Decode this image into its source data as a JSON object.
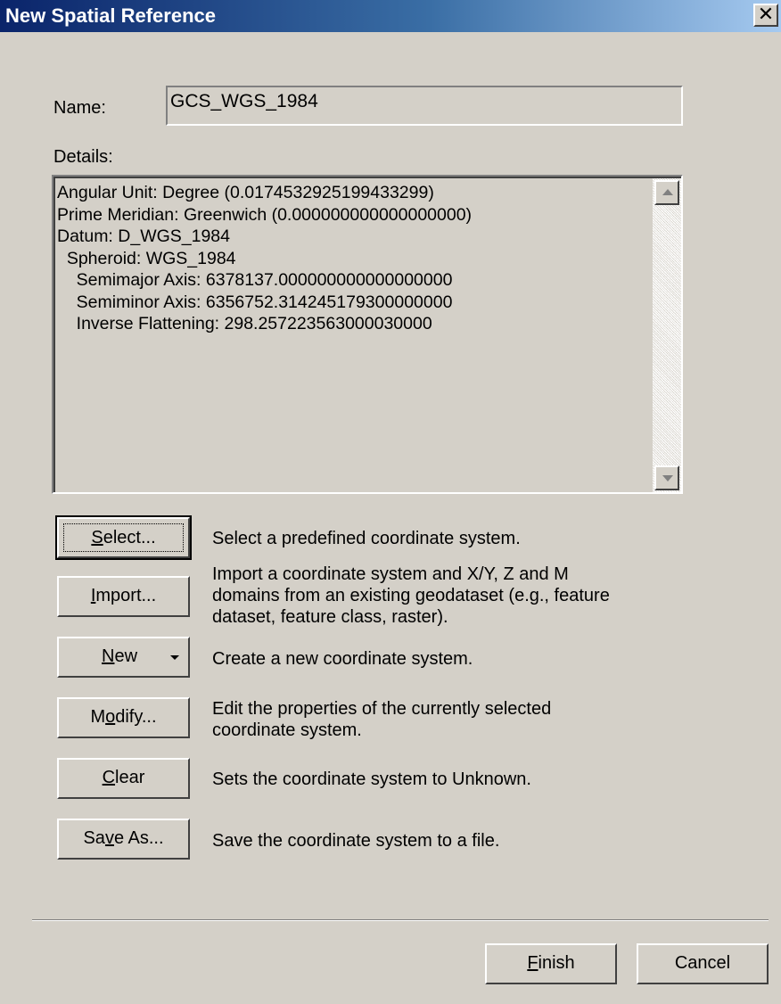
{
  "window": {
    "title": "New Spatial Reference",
    "close_glyph": "✕"
  },
  "name": {
    "label": "Name:",
    "value": "GCS_WGS_1984"
  },
  "details": {
    "label": "Details:",
    "lines": [
      "Angular Unit: Degree (0.0174532925199433299)",
      "Prime Meridian: Greenwich (0.000000000000000000)",
      "Datum: D_WGS_1984",
      "  Spheroid: WGS_1984",
      "    Semimajor Axis: 6378137.000000000000000000",
      "    Semiminor Axis: 6356752.314245179300000000",
      "    Inverse Flattening: 298.257223563000030000"
    ]
  },
  "actions": [
    {
      "id": "select",
      "label_before": "",
      "label_accel": "S",
      "label_after": "elect...",
      "description": "Select a predefined coordinate system."
    },
    {
      "id": "import",
      "label_before": "",
      "label_accel": "I",
      "label_after": "mport...",
      "description": "Import a coordinate system and X/Y, Z and M domains from an existing geodataset (e.g., feature dataset, feature class, raster)."
    },
    {
      "id": "new",
      "label_before": "",
      "label_accel": "N",
      "label_after": "ew",
      "description": "Create a new coordinate system."
    },
    {
      "id": "modify",
      "label_before": "M",
      "label_accel": "o",
      "label_after": "dify...",
      "description": "Edit the properties of the currently selected coordinate system."
    },
    {
      "id": "clear",
      "label_before": "",
      "label_accel": "C",
      "label_after": "lear",
      "description": "Sets the coordinate system to Unknown."
    },
    {
      "id": "save_as",
      "label_before": "Sa",
      "label_accel": "v",
      "label_after": "e As...",
      "description": "Save the coordinate system to a file."
    }
  ],
  "footer": {
    "finish_accel": "F",
    "finish_rest": "inish",
    "cancel": "Cancel"
  },
  "icons": {
    "close": "close-icon",
    "scroll_up": "scroll-up-arrow-icon",
    "scroll_down": "scroll-down-arrow-icon",
    "dropdown": "dropdown-arrow-icon"
  },
  "colors": {
    "face": "#d4d0c8",
    "title_start": "#0a246a",
    "title_end": "#a6caf0"
  }
}
